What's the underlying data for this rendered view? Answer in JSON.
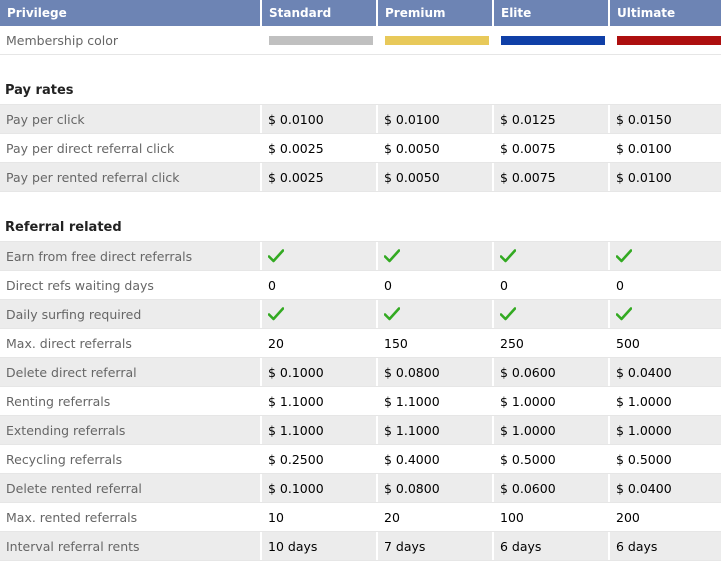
{
  "header": {
    "privilege": "Privilege",
    "tiers": [
      "Standard",
      "Premium",
      "Elite",
      "Ultimate"
    ]
  },
  "membership_color": {
    "label": "Membership color",
    "colors": [
      "#c0c0c0",
      "#e8c95a",
      "#0f3fa7",
      "#ad0f0f"
    ]
  },
  "sections": {
    "pay_rates": "Pay rates",
    "referral_related": "Referral related"
  },
  "pay_rates": [
    {
      "label": "Pay per click",
      "values": [
        "$ 0.0100",
        "$ 0.0100",
        "$ 0.0125",
        "$ 0.0150"
      ]
    },
    {
      "label": "Pay per direct referral click",
      "values": [
        "$ 0.0025",
        "$ 0.0050",
        "$ 0.0075",
        "$ 0.0100"
      ]
    },
    {
      "label": "Pay per rented referral click",
      "values": [
        "$ 0.0025",
        "$ 0.0050",
        "$ 0.0075",
        "$ 0.0100"
      ]
    }
  ],
  "referral_rows": [
    {
      "label": "Earn from free direct referrals",
      "values": [
        "check-icon",
        "check-icon",
        "check-icon",
        "check-icon"
      ]
    },
    {
      "label": "Direct refs waiting days",
      "values": [
        "0",
        "0",
        "0",
        "0"
      ]
    },
    {
      "label": "Daily surfing required",
      "values": [
        "check-icon",
        "check-icon",
        "check-icon",
        "check-icon"
      ]
    },
    {
      "label": "Max. direct referrals",
      "values": [
        "20",
        "150",
        "250",
        "500"
      ]
    },
    {
      "label": "Delete direct referral",
      "values": [
        "$ 0.1000",
        "$ 0.0800",
        "$ 0.0600",
        "$ 0.0400"
      ]
    },
    {
      "label": "Renting referrals",
      "values": [
        "$ 1.1000",
        "$ 1.1000",
        "$ 1.0000",
        "$ 1.0000"
      ]
    },
    {
      "label": "Extending referrals",
      "values": [
        "$ 1.1000",
        "$ 1.1000",
        "$ 1.0000",
        "$ 1.0000"
      ]
    },
    {
      "label": "Recycling referrals",
      "values": [
        "$ 0.2500",
        "$ 0.4000",
        "$ 0.5000",
        "$ 0.5000"
      ]
    },
    {
      "label": "Delete rented referral",
      "values": [
        "$ 0.1000",
        "$ 0.0800",
        "$ 0.0600",
        "$ 0.0400"
      ]
    },
    {
      "label": "Max. rented referrals",
      "values": [
        "10",
        "20",
        "100",
        "200"
      ]
    },
    {
      "label": "Interval referral rents",
      "values": [
        "10 days",
        "7 days",
        "6 days",
        "6 days"
      ]
    }
  ],
  "check_color": "#33aa22"
}
